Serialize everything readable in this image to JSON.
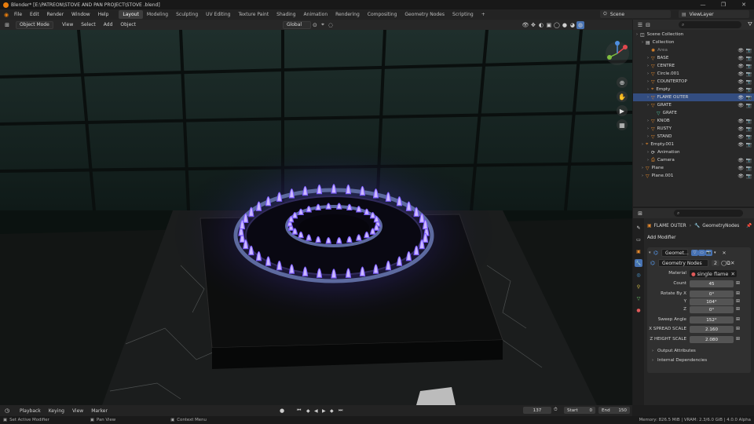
{
  "window": {
    "title": "Blender* [E:\\PATREON\\STOVE AND PAN PROJECT\\STOVE .blend]",
    "controls": [
      "—",
      "❐",
      "✕"
    ]
  },
  "menu": [
    "File",
    "Edit",
    "Render",
    "Window",
    "Help"
  ],
  "workspaces": [
    "Layout",
    "Modeling",
    "Sculpting",
    "UV Editing",
    "Texture Paint",
    "Shading",
    "Animation",
    "Rendering",
    "Compositing",
    "Geometry Nodes",
    "Scripting"
  ],
  "active_workspace": "Layout",
  "add_workspace": "+",
  "scene": "Scene",
  "view_layer": "ViewLayer",
  "viewport_header": {
    "mode": "Object Mode",
    "menus": [
      "View",
      "Select",
      "Add",
      "Object"
    ],
    "transform_orientation": "Global"
  },
  "outliner": {
    "search_placeholder": "",
    "rows": [
      {
        "label": "Scene Collection",
        "type": "scene",
        "depth": 0
      },
      {
        "label": "Collection",
        "type": "collection",
        "depth": 1
      },
      {
        "label": "Area",
        "type": "light",
        "depth": 2
      },
      {
        "label": "BASE",
        "type": "mesh",
        "depth": 2
      },
      {
        "label": "CENTRE",
        "type": "mesh",
        "depth": 2
      },
      {
        "label": "Circle.001",
        "type": "mesh",
        "depth": 2
      },
      {
        "label": "COUNTERTOP",
        "type": "mesh",
        "depth": 2
      },
      {
        "label": "Empty",
        "type": "empty",
        "depth": 2
      },
      {
        "label": "FLAME OUTER",
        "type": "mesh",
        "depth": 2,
        "selected": true
      },
      {
        "label": "GRATE",
        "type": "mesh",
        "depth": 2
      },
      {
        "label": "GRATE",
        "type": "meshdata",
        "depth": 3
      },
      {
        "label": "KNOB",
        "type": "mesh",
        "depth": 2
      },
      {
        "label": "RUSTY",
        "type": "mesh",
        "depth": 2
      },
      {
        "label": "STAND",
        "type": "mesh",
        "depth": 2
      },
      {
        "label": "Empty.001",
        "type": "empty",
        "depth": 1
      },
      {
        "label": "Animation",
        "type": "anim",
        "depth": 2
      },
      {
        "label": "Camera",
        "type": "camera",
        "depth": 2
      },
      {
        "label": "Plane",
        "type": "mesh",
        "depth": 1
      },
      {
        "label": "Plane.001",
        "type": "mesh",
        "depth": 1
      }
    ]
  },
  "properties": {
    "breadcrumb_object": "FLAME OUTER",
    "breadcrumb_sep": "›",
    "breadcrumb_modifier": "GeometryNodes",
    "add_modifier": "Add Modifier",
    "modifier_name": "Geomet…",
    "node_group": "Geometry Nodes",
    "node_group_users": "2",
    "material_label": "Material",
    "material_value": "single flame",
    "fields": [
      {
        "label": "Count",
        "value": "45"
      },
      {
        "label": "Rotate By X",
        "value": "0°"
      },
      {
        "label": "Y",
        "value": "104°"
      },
      {
        "label": "Z",
        "value": "0°"
      },
      {
        "label": "Sweep Angle",
        "value": "152°"
      },
      {
        "label": "X SPREAD SCALE",
        "value": "2.160"
      },
      {
        "label": "Z HEIGHT SCALE",
        "value": "2.080"
      }
    ],
    "subpanels": [
      "Output Attributes",
      "Internal Dependencies"
    ]
  },
  "timeline": {
    "menus": [
      "Playback",
      "Keying",
      "View",
      "Marker"
    ],
    "current_frame": "137",
    "start_label": "Start",
    "start": "0",
    "end_label": "End",
    "end": "150"
  },
  "statusbar": {
    "left": [
      "Set Active Modifier",
      "Pan View",
      "Context Menu"
    ],
    "right": "Memory: 826.5 MiB | VRAM: 2.3/6.0 GiB | 4.0.0 Alpha"
  },
  "colors": {
    "accent": "#334d80",
    "flame": "#7b5cff",
    "mesh_icon": "#e6892b",
    "meshdata_icon": "#4fc3a1"
  }
}
